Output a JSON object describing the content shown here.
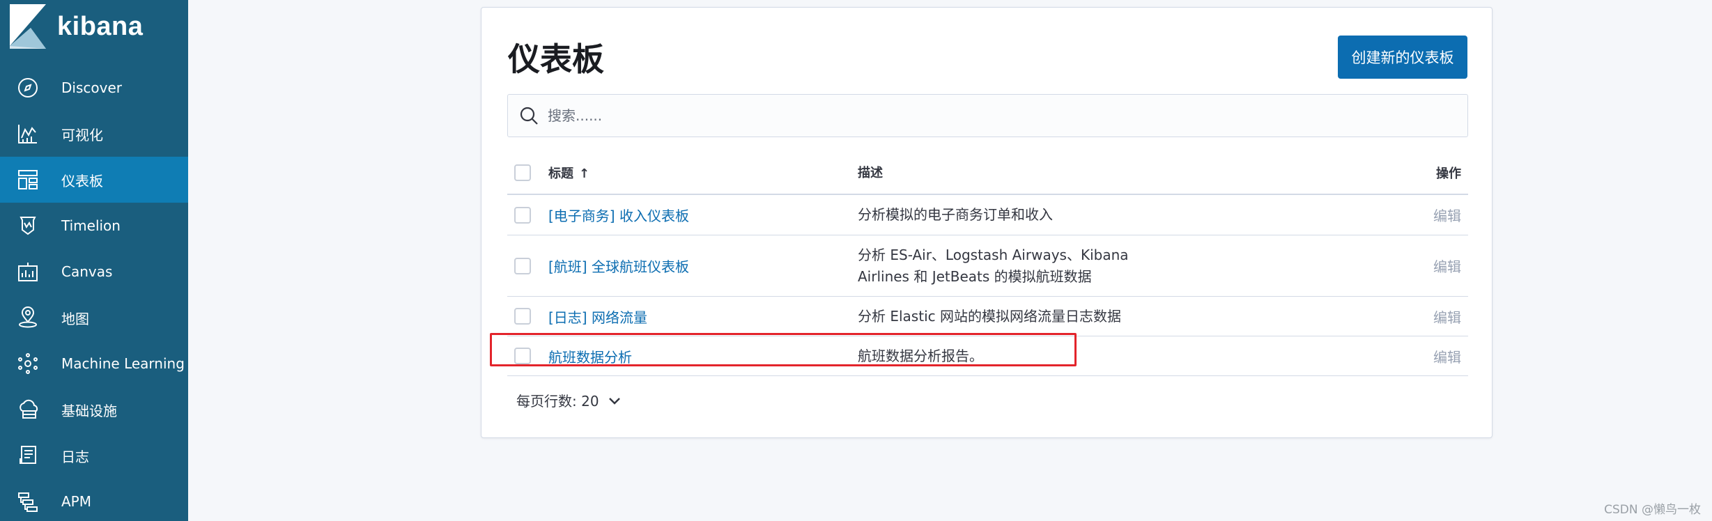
{
  "app": {
    "name": "kibana"
  },
  "sidebar": {
    "items": [
      {
        "label": "Discover",
        "icon": "compass-icon"
      },
      {
        "label": "可视化",
        "icon": "chart-icon"
      },
      {
        "label": "仪表板",
        "icon": "dashboard-icon",
        "active": true
      },
      {
        "label": "Timelion",
        "icon": "timelion-icon"
      },
      {
        "label": "Canvas",
        "icon": "canvas-icon"
      },
      {
        "label": "地图",
        "icon": "map-pin-icon"
      },
      {
        "label": "Machine Learning",
        "icon": "machine-learning-icon"
      },
      {
        "label": "基础设施",
        "icon": "infrastructure-icon"
      },
      {
        "label": "日志",
        "icon": "logs-icon"
      },
      {
        "label": "APM",
        "icon": "apm-icon"
      }
    ]
  },
  "main": {
    "title": "仪表板",
    "create_button": "创建新的仪表板",
    "search_placeholder": "搜索......",
    "columns": {
      "title": "标题",
      "sort_indicator": "↑",
      "description": "描述",
      "actions": "操作"
    },
    "rows": [
      {
        "title": "[电子商务] 收入仪表板",
        "description": [
          "分析模拟的电子商务订单和收入"
        ],
        "action": "编辑"
      },
      {
        "title": "[航班] 全球航班仪表板",
        "description": [
          "分析 ES-Air、Logstash Airways、Kibana",
          "Airlines 和 JetBeats 的模拟航班数据"
        ],
        "action": "编辑"
      },
      {
        "title": "[日志] 网络流量",
        "description": [
          "分析 Elastic 网站的模拟网络流量日志数据"
        ],
        "action": "编辑"
      },
      {
        "title": "航班数据分析",
        "description": [
          "航班数据分析报告。"
        ],
        "action": "编辑"
      }
    ],
    "pagination": {
      "label": "每页行数: 20"
    }
  },
  "watermark": "CSDN @懒鸟一枚",
  "colors": {
    "sidebar": "#1a5e7e",
    "sidebar_active": "#0f7db4",
    "primary": "#0c6db1",
    "highlight": "#e3242b"
  }
}
